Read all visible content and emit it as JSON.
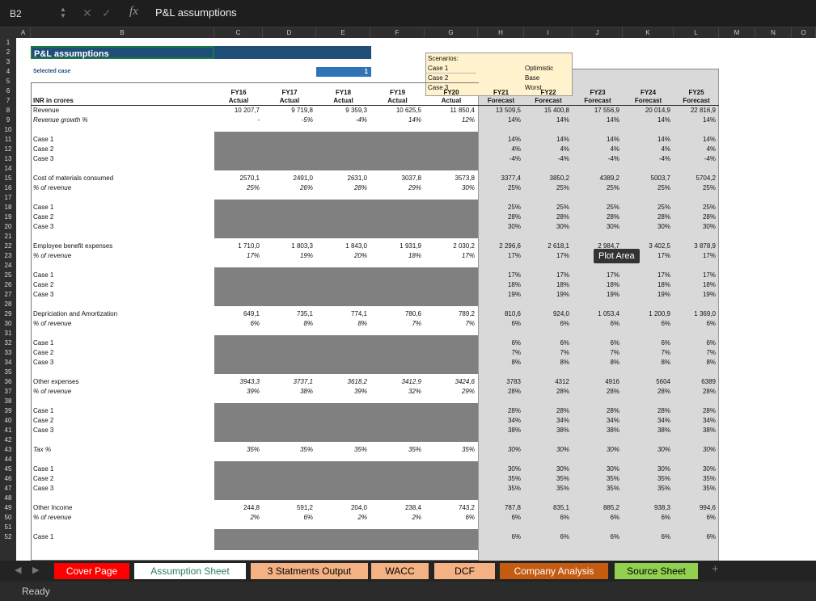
{
  "formula_bar": {
    "name_box": "B2",
    "formula": "P&L assumptions"
  },
  "columns": [
    "A",
    "B",
    "C",
    "D",
    "E",
    "F",
    "G",
    "H",
    "I",
    "J",
    "K",
    "L",
    "M",
    "N",
    "O"
  ],
  "title": "P&L assumptions",
  "selected_case_label": "Selected case",
  "selected_case_value": "1",
  "scenarios": {
    "header": "Scenarios:",
    "rows": [
      [
        "Case 1",
        "Optimistic"
      ],
      [
        "Case 2",
        "Base"
      ],
      [
        "Case 3",
        "Worst"
      ]
    ]
  },
  "table_label": "INR in crores",
  "years": [
    "FY16",
    "FY17",
    "FY18",
    "FY19",
    "FY20",
    "FY21",
    "FY22",
    "FY23",
    "FY24",
    "FY25"
  ],
  "year_types": [
    "Actual",
    "Actual",
    "Actual",
    "Actual",
    "Actual",
    "Forecast",
    "Forecast",
    "Forecast",
    "Forecast",
    "Forecast"
  ],
  "sections": [
    {
      "row": 8,
      "label": "Revenue",
      "values": [
        "10 207,7",
        "9 719,8",
        "9 359,3",
        "10 625,5",
        "11 850,4",
        "13 509,5",
        "15 400,8",
        "17 556,9",
        "20 014,9",
        "22 816,9"
      ],
      "sub_label": "Revenue growth %",
      "sub_values": [
        "-",
        "-5%",
        "-4%",
        "14%",
        "12%",
        "14%",
        "14%",
        "14%",
        "14%",
        "14%"
      ],
      "cases": [
        11,
        [
          "14%",
          "14%",
          "14%",
          "14%",
          "14%"
        ],
        [
          "4%",
          "4%",
          "4%",
          "4%",
          "4%"
        ],
        [
          "-4%",
          "-4%",
          "-4%",
          "-4%",
          "-4%"
        ]
      ]
    },
    {
      "row": 15,
      "label": "Cost of materials consumed",
      "values": [
        "2570,1",
        "2491,0",
        "2631,0",
        "3037,8",
        "3573,8",
        "3377,4",
        "3850,2",
        "4389,2",
        "5003,7",
        "5704,2"
      ],
      "sub_label": "% of revenue",
      "sub_values": [
        "25%",
        "26%",
        "28%",
        "29%",
        "30%",
        "25%",
        "25%",
        "25%",
        "25%",
        "25%"
      ],
      "cases": [
        18,
        [
          "25%",
          "25%",
          "25%",
          "25%",
          "25%"
        ],
        [
          "28%",
          "28%",
          "28%",
          "28%",
          "28%"
        ],
        [
          "30%",
          "30%",
          "30%",
          "30%",
          "30%"
        ]
      ]
    },
    {
      "row": 22,
      "label": "Employee benefit expenses",
      "values": [
        "1 710,0",
        "1 803,3",
        "1 843,0",
        "1 931,9",
        "2 030,2",
        "2 296,6",
        "2 618,1",
        "2 984,7",
        "3 402,5",
        "3 878,9"
      ],
      "sub_label": "% of revenue",
      "sub_values": [
        "17%",
        "19%",
        "20%",
        "18%",
        "17%",
        "17%",
        "17%",
        "",
        "17%",
        "17%"
      ],
      "cases": [
        25,
        [
          "17%",
          "17%",
          "17%",
          "17%",
          "17%"
        ],
        [
          "18%",
          "18%",
          "18%",
          "18%",
          "18%"
        ],
        [
          "19%",
          "19%",
          "19%",
          "19%",
          "19%"
        ]
      ]
    },
    {
      "row": 29,
      "label": "Depriciation and Amortization",
      "values": [
        "649,1",
        "735,1",
        "774,1",
        "780,6",
        "789,2",
        "810,6",
        "924,0",
        "1 053,4",
        "1 200,9",
        "1 369,0"
      ],
      "sub_label": "% of revenue",
      "sub_values": [
        "6%",
        "8%",
        "8%",
        "7%",
        "7%",
        "6%",
        "6%",
        "6%",
        "6%",
        "6%"
      ],
      "cases": [
        32,
        [
          "6%",
          "6%",
          "6%",
          "6%",
          "6%"
        ],
        [
          "7%",
          "7%",
          "7%",
          "7%",
          "7%"
        ],
        [
          "8%",
          "8%",
          "8%",
          "8%",
          "8%"
        ]
      ]
    },
    {
      "row": 36,
      "label": "Other expenses",
      "values": [
        "3943,3",
        "3737,1",
        "3618,2",
        "3412,9",
        "3424,6",
        "3783",
        "4312",
        "4916",
        "5604",
        "6389"
      ],
      "sub_label": "% of revenue",
      "sub_values": [
        "39%",
        "38%",
        "39%",
        "32%",
        "29%",
        "28%",
        "28%",
        "28%",
        "28%",
        "28%"
      ],
      "cases": [
        39,
        [
          "28%",
          "28%",
          "28%",
          "28%",
          "28%"
        ],
        [
          "34%",
          "34%",
          "34%",
          "34%",
          "34%"
        ],
        [
          "38%",
          "38%",
          "38%",
          "38%",
          "38%"
        ]
      ]
    },
    {
      "row": 43,
      "label": "Tax %",
      "values": [
        "35%",
        "35%",
        "35%",
        "35%",
        "35%",
        "30%",
        "30%",
        "30%",
        "30%",
        "30%"
      ],
      "sub_label": "",
      "sub_values": [],
      "cases": [
        45,
        [
          "30%",
          "30%",
          "30%",
          "30%",
          "30%"
        ],
        [
          "35%",
          "35%",
          "35%",
          "35%",
          "35%"
        ],
        [
          "35%",
          "35%",
          "35%",
          "35%",
          "35%"
        ]
      ]
    },
    {
      "row": 49,
      "label": "Other Income",
      "values": [
        "244,8",
        "591,2",
        "204,0",
        "238,4",
        "743,2",
        "787,8",
        "835,1",
        "885,2",
        "938,3",
        "994,6"
      ],
      "sub_label": "% of revenue",
      "sub_values": [
        "2%",
        "6%",
        "2%",
        "2%",
        "6%",
        "6%",
        "6%",
        "6%",
        "6%",
        "6%"
      ],
      "cases": [
        52,
        [
          "6%",
          "6%",
          "6%",
          "6%",
          "6%"
        ]
      ]
    }
  ],
  "case_labels": [
    "Case 1",
    "Case 2",
    "Case 3"
  ],
  "tooltip": "Plot Area",
  "tabs": [
    {
      "label": "Cover Page",
      "bg": "#ff0000",
      "fg": "#ffffff"
    },
    {
      "label": "Assumption Sheet",
      "bg": "#ffffff",
      "fg": "#2e7d5b"
    },
    {
      "label": "3 Statments Output",
      "bg": "#f4b183",
      "fg": "#000000"
    },
    {
      "label": "WACC",
      "bg": "#f4b183",
      "fg": "#000000"
    },
    {
      "label": "DCF",
      "bg": "#f4b183",
      "fg": "#000000"
    },
    {
      "label": "Company Analysis",
      "bg": "#c55a11",
      "fg": "#ffffff"
    },
    {
      "label": "Source Sheet",
      "bg": "#92d050",
      "fg": "#000000"
    }
  ],
  "add_sheet": "+",
  "status": "Ready"
}
